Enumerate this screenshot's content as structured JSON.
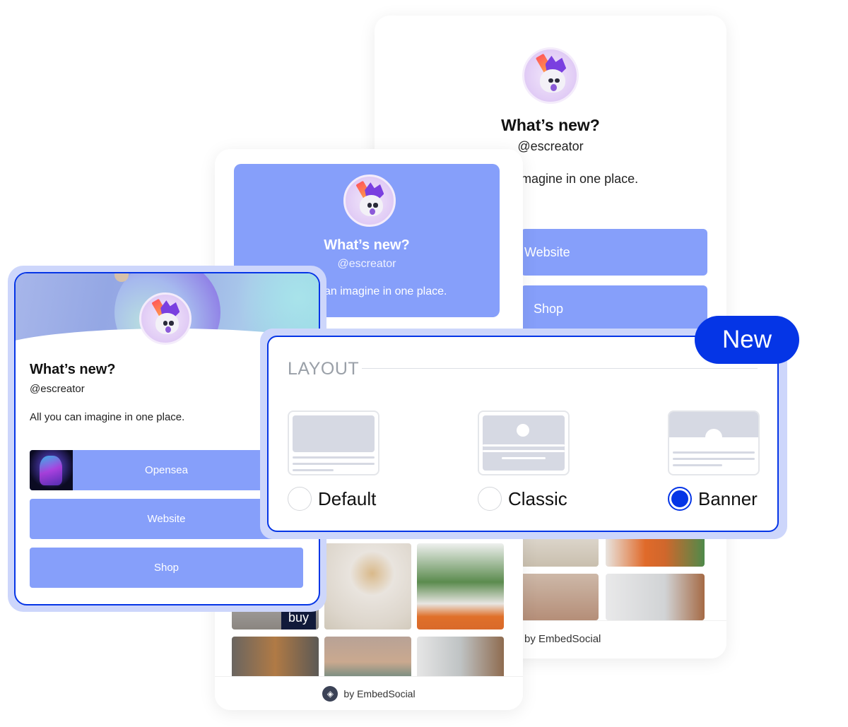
{
  "colors": {
    "accent": "#0535e6",
    "button": "#869ffa",
    "panel_halo": "#cdd6fb",
    "muted_text": "#9aa0a8"
  },
  "profile": {
    "title": "What’s new?",
    "handle": "@escreator",
    "description": "All you can imagine in one place.",
    "description_partial_mid": "can imagine in one place.",
    "description_partial_back": "magine in one place."
  },
  "back_card": {
    "buttons": [
      "Website",
      "Shop"
    ],
    "footer": "by EmbedSocial"
  },
  "mid_card": {
    "buy_tag": "buy",
    "footer": "by EmbedSocial"
  },
  "front_card": {
    "buttons": [
      "Opensea",
      "Website",
      "Shop"
    ]
  },
  "layout_panel": {
    "heading": "LAYOUT",
    "badge": "New",
    "options": [
      {
        "label": "Default",
        "selected": false
      },
      {
        "label": "Classic",
        "selected": false
      },
      {
        "label": "Banner",
        "selected": true
      }
    ]
  },
  "icons": {
    "avatar": "unicorn-avatar",
    "embedsocial": "embedsocial-logo-icon"
  }
}
